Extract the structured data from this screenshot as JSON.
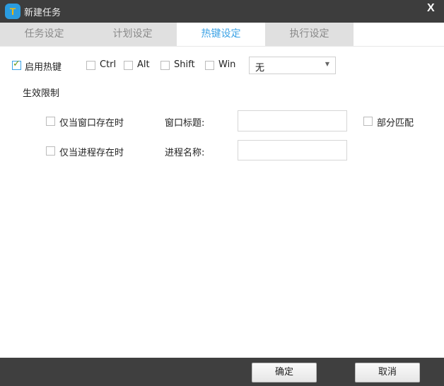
{
  "window": {
    "title": "新建任务",
    "close": "X",
    "logo": "T"
  },
  "tabs": [
    {
      "label": "任务设定"
    },
    {
      "label": "计划设定"
    },
    {
      "label": "热键设定",
      "active": true
    },
    {
      "label": "执行设定"
    }
  ],
  "hotkey": {
    "enable_label": "启用热键",
    "enabled": true,
    "modifiers": [
      {
        "label": "Ctrl",
        "checked": false
      },
      {
        "label": "Alt",
        "checked": false
      },
      {
        "label": "Shift",
        "checked": false
      },
      {
        "label": "Win",
        "checked": false
      }
    ],
    "key_value": "无"
  },
  "limits": {
    "heading": "生效限制",
    "window_only": {
      "label": "仅当窗口存在时",
      "checked": false
    },
    "window_title_label": "窗口标题:",
    "window_title_value": "",
    "partial_match": {
      "label": "部分匹配",
      "checked": false
    },
    "process_only": {
      "label": "仅当进程存在时",
      "checked": false
    },
    "process_name_label": "进程名称:",
    "process_name_value": ""
  },
  "footer": {
    "ok": "确定",
    "cancel": "取消"
  },
  "colors": {
    "accent": "#3ca3e6",
    "titlebar": "#3d3d3d"
  }
}
